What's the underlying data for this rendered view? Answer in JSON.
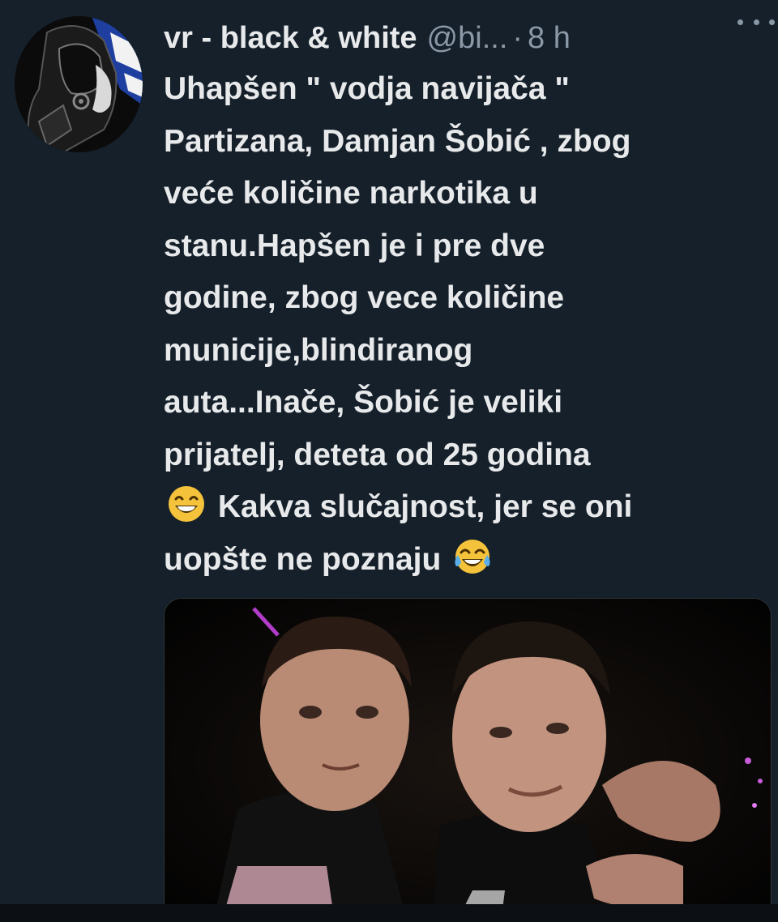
{
  "tweet": {
    "display_name": "vr - black & white",
    "handle": "@bi...",
    "separator": "·",
    "time": "8 h",
    "text_part1": "Uhapšen \" vodja navijača \"\nPartizana, Damjan Šobić , zbog\nveće količine narkotika u\nstanu.Hapšen je i pre dve\ngodine, zbog vece količine\nmunicije,blindiranog\nauta...Inače, Šobić je veliki\nprijatelj, deteta od 25 godina\n",
    "text_part2": " Kakva slučajnost, jer se oni\nuopšte ne poznaju ",
    "emoji_1": "grinning-face-with-smiling-eyes",
    "emoji_2": "face-with-tears-of-joy"
  },
  "colors": {
    "background": "#15202b",
    "text_primary": "#e7e9ea",
    "text_secondary": "#8b98a5",
    "avatar_accent": "#1e3fa0"
  },
  "icons": {
    "more": "more-horizontal-icon"
  }
}
